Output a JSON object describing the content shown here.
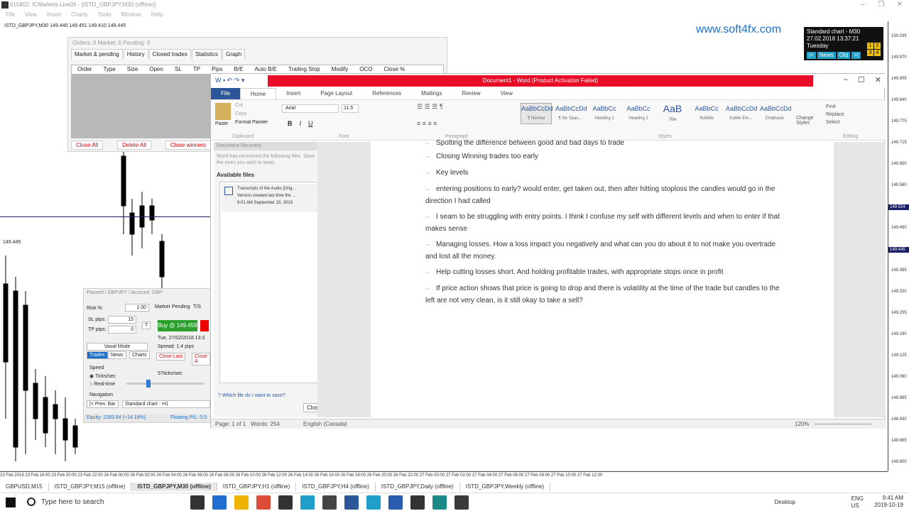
{
  "mt4": {
    "title": "615802: ICMarkets-Live05 - [ISTD_GBPJPY,M30 (offline)]",
    "menu": [
      "File",
      "View",
      "Insert",
      "Charts",
      "Tools",
      "Window",
      "Help"
    ],
    "chart_symbol": "ISTD_GBPJPY,M30 149.440 149.451 149.410 149.445",
    "watermark": "www.soft4fx.com",
    "info": {
      "line1": "Standard chart - M30",
      "line2": "27.02.2018     13:37:21",
      "line3": "Tuesday",
      "buttons": [
        "|<",
        "News",
        "Obj",
        ">|"
      ],
      "squares": [
        "1",
        "2",
        "3",
        "4"
      ]
    },
    "hline_price": "149.445",
    "price_ticks": [
      "150.035",
      "149.970",
      "149.905",
      "149.840",
      "149.775",
      "149.715",
      "149.650",
      "149.580",
      "149.524",
      "149.490",
      "149.445",
      "149.385",
      "149.320",
      "149.255",
      "149.190",
      "149.125",
      "149.060",
      "148.995",
      "148.930",
      "148.865",
      "148.800"
    ],
    "time_axis": "23 Feb 2018   23 Feb 18:00   23 Feb 20:00   23 Feb 22:00   26 Feb 00:00   26 Feb 02:00   26 Feb 04:00   26 Feb 06:00   26 Feb 08:00   26 Feb 10:00   26 Feb 12:00   26 Feb 14:00   26 Feb 16:00   26 Feb 18:00   26 Feb 20:00   26 Feb 22:00   27 Feb 00:00   27 Feb 02:00   27 Feb 04:00   27 Feb 06:00   27 Feb 08:00   27 Feb 10:00   27 Feb 12:00",
    "chart_tabs": [
      "GBPUSD,M15",
      "ISTD_GBPJPY,M15 (offline)",
      "ISTD_GBPJPY,M30 (offline)",
      "ISTD_GBPJPY,H1 (offline)",
      "ISTD_GBPJPY,H4 (offline)",
      "ISTD_GBPJPY,Daily (offline)",
      "ISTD_GBPJPY,Weekly (offline)"
    ],
    "orders": {
      "header": "Orders: 0     Market: 0     Pending: 0",
      "tabs": [
        "Market & pending",
        "History",
        "Closed trades",
        "Statistics",
        "Graph"
      ],
      "columns": [
        "Order",
        "Type",
        "Size",
        "Open",
        "SL",
        "TP",
        "Pips",
        "B/E",
        "Auto B/E",
        "Trailing Stop",
        "Modify",
        "OCO",
        "Close %"
      ],
      "footer": [
        "Close All",
        "Delete All",
        "Close winners"
      ]
    },
    "sim": {
      "title": "Paused / GBPJPY / Account: GBP",
      "risk_label": "Risk %",
      "risk_value": "1.00",
      "tabs": [
        "Market",
        "Pending",
        "T/S"
      ],
      "sl_label": "SL pips:",
      "sl_value": "15",
      "tp_label": "TP pips:",
      "tp_value": "0",
      "t_label": "T",
      "buy": "Buy @ 149.459",
      "date": "Tue, 27/02/2018  13:3",
      "spread": "Spread:  1.4 pips",
      "close_last": "Close Last",
      "close_all": "Close A",
      "mode": "Vaual Mode",
      "mode_tabs": [
        "Trades",
        "News",
        "Charts"
      ],
      "speed": "Speed",
      "ticks": "Ticks/sec",
      "realtime": "Real-time",
      "rate": "57ticks/sec",
      "navigation": "Navigation",
      "prev": "|< Prev. Bar",
      "chart_select": "Standard chart - H1",
      "equity": "Equity:  2283.64  (+14.18%)",
      "floating": "Floating P/L:  0.0"
    }
  },
  "word": {
    "title": "Document1 - Word (Product Activation Failed)",
    "tabs": [
      "File",
      "Home",
      "Insert",
      "Page Layout",
      "References",
      "Mailings",
      "Review",
      "View"
    ],
    "font": "Arial",
    "size": "11.5",
    "cut": "Cut",
    "copy": "Copy",
    "format_painter": "Format Painter",
    "paste": "Paste",
    "groups": [
      "Clipboard",
      "Font",
      "Paragraph",
      "Styles",
      "Editing"
    ],
    "styles": [
      {
        "sample": "AaBbCcDd",
        "label": "¶ Normal"
      },
      {
        "sample": "AaBbCcDd",
        "label": "¶ No Spac..."
      },
      {
        "sample": "AaBbCc",
        "label": "Heading 1"
      },
      {
        "sample": "AaBbCc",
        "label": "Heading 2"
      },
      {
        "sample": "AaB",
        "label": "Title"
      },
      {
        "sample": "AaBbCc",
        "label": "Subtitle"
      },
      {
        "sample": "AaBbCcDd",
        "label": "Subtle Em..."
      },
      {
        "sample": "AaBbCcDd",
        "label": "Emphasis"
      }
    ],
    "change_styles": "Change Styles",
    "editing": [
      "Find",
      "Replace",
      "Select"
    ],
    "recovery": {
      "header": "Document Recovery",
      "message": "Word has recovered the following files. Save the ones you wish to keep.",
      "available": "Available files",
      "item_title": "Transcripts of the Audio  [Orig...",
      "item_sub": "Version created last time the ...",
      "item_time": "8:01 AM September 23, 2019",
      "which": "Which file do I want to save?",
      "close": "Close"
    },
    "doc_lines": [
      "Spotting the difference between good and bad days to trade",
      "Closing Winning trades too early",
      "Key levels",
      "entering positions to early? would enter, get taken out, then after hitting stoploss the candles would go in the direction I had called",
      "I seam to be struggling with entry points. I think I confuse my self with different levels and when to enter if that makes sense",
      "Managing losses. How a loss impact you negatively and what can you do about it to not make you overtrade and lost all the money.",
      "Help cutting losses short. And holding profitable trades, with appropriate stops once in profit",
      "If price action shows that price is going to drop and there is volatility at the time of the trade but candles to the left are not very clean, is it still okay to take a sell?"
    ],
    "status": {
      "page": "Page: 1 of 1",
      "words": "Words: 254",
      "lang": "English (Canada)",
      "zoom": "120%"
    }
  },
  "taskbar": {
    "search": "Type here to search",
    "desktop": "Desktop",
    "lang1": "ENG",
    "lang2": "US",
    "time": "9:41 AM",
    "date": "2019-10-19",
    "app_colors": [
      "#333333",
      "#1e6fd0",
      "#f0b400",
      "#dd4b39",
      "#333333",
      "#1fa0c9",
      "#444444",
      "#2b579a",
      "#1fa0c9",
      "#2a5db0",
      "#333333",
      "#1d8a8a",
      "#3a3a3a"
    ]
  }
}
